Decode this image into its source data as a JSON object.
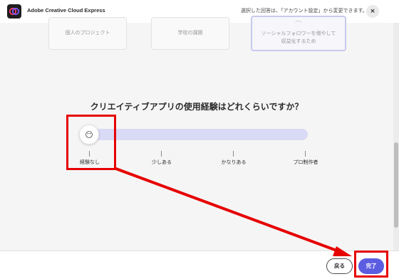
{
  "header": {
    "app_title": "Adobe Creative Cloud Express",
    "note": "選択した回答は、「アカウント設定」から変更できます。",
    "close_label": "×"
  },
  "cards": [
    {
      "label": "個人のプロジェクト"
    },
    {
      "label": "学校の課題"
    },
    {
      "label": "ソーシャルフォロワーを増やして収益化するため"
    }
  ],
  "question": "クリエイティブアプリの使用経験はどれくらいですか？",
  "slider": {
    "handle_emoji": "😶",
    "level_index": 0,
    "levels": [
      "経験なし",
      "少しある",
      "かなりある",
      "プロ制作者"
    ]
  },
  "footer": {
    "back_label": "戻る",
    "done_label": "完了"
  },
  "colors": {
    "accent": "#5b5ce0",
    "track": "#d9daf5",
    "annotation": "#e60000"
  }
}
